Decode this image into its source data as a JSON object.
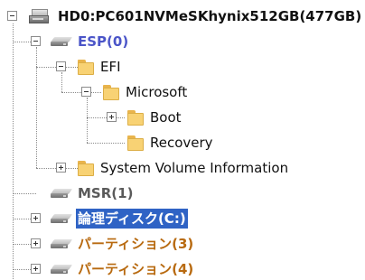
{
  "colors": {
    "partition_blue": "#4b55c8",
    "partition_gray": "#5a5a5a",
    "partition_orange": "#b86a10",
    "selection_bg": "#2f63c5",
    "selection_text": "#ffffff"
  },
  "tree": {
    "root": {
      "label": "HD0:PC601NVMeSKhynix512GB(477GB)",
      "icon": "hard-disk-icon",
      "expanded": true
    },
    "esp": {
      "label": "ESP(0)",
      "icon": "drive-icon",
      "expanded": true
    },
    "efi": {
      "label": "EFI",
      "icon": "folder-icon",
      "expanded": true
    },
    "microsoft": {
      "label": "Microsoft",
      "icon": "folder-icon",
      "expanded": true
    },
    "boot": {
      "label": "Boot",
      "icon": "folder-icon",
      "expanded": false
    },
    "recovery": {
      "label": "Recovery",
      "icon": "folder-icon"
    },
    "system_volume": {
      "label": "System Volume Information",
      "icon": "folder-icon",
      "expanded": false
    },
    "msr": {
      "label": "MSR(1)",
      "icon": "drive-icon"
    },
    "logical_c": {
      "label": "論理ディスク(C:)",
      "icon": "drive-icon",
      "expanded": false,
      "selected": true
    },
    "partition3": {
      "label": "パーティション(3)",
      "icon": "drive-icon",
      "expanded": false
    },
    "partition4": {
      "label": "パーティション(4)",
      "icon": "drive-icon",
      "expanded": false
    }
  }
}
